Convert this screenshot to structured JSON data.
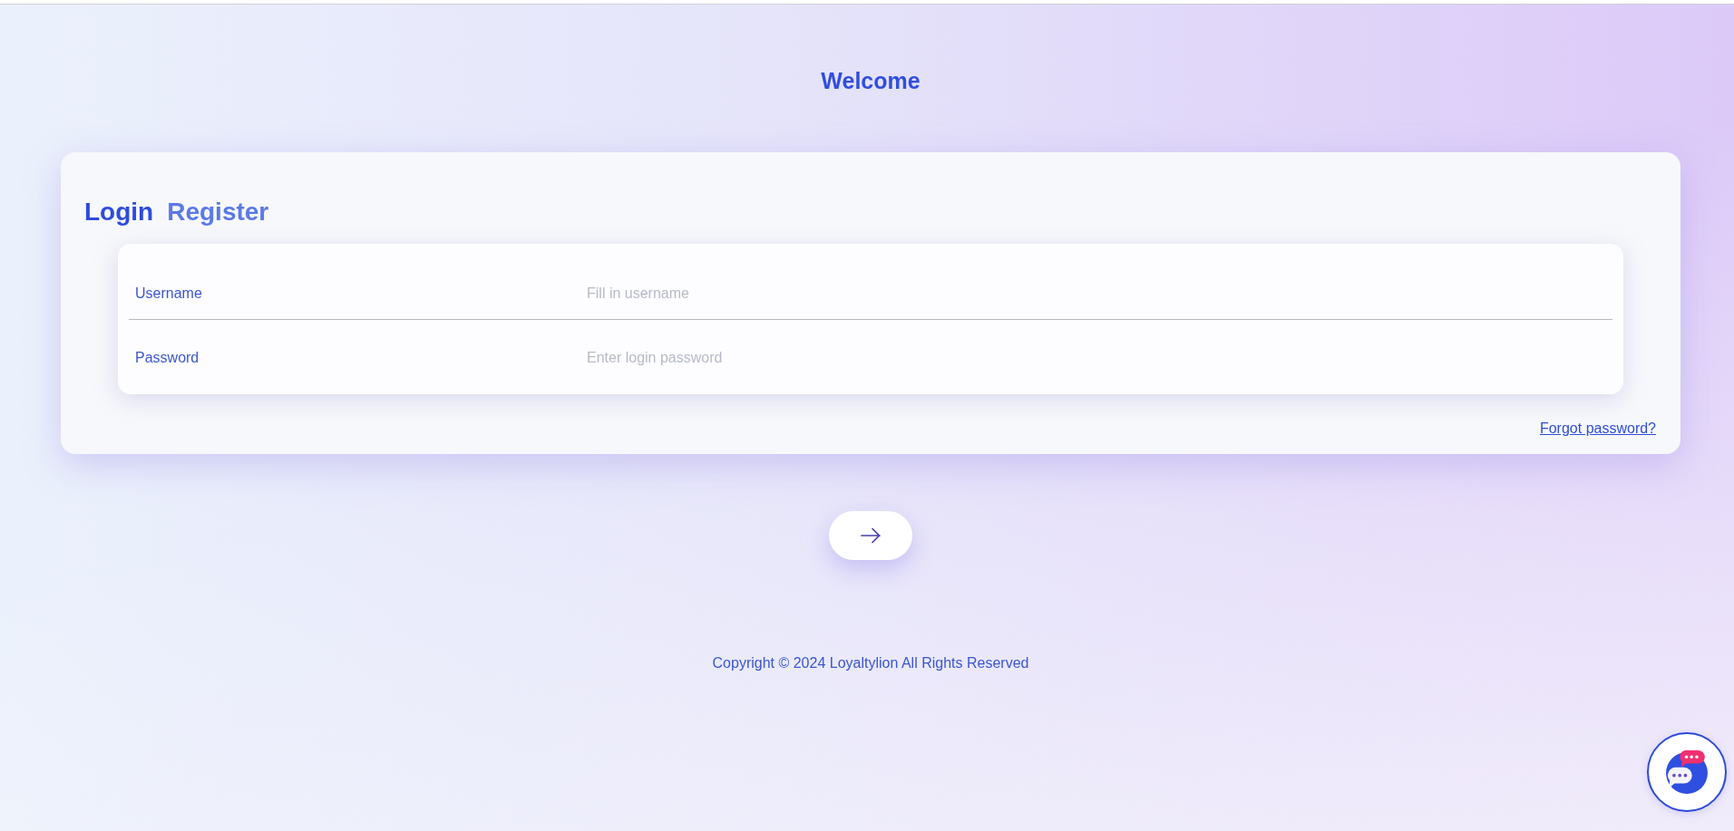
{
  "heading": "Welcome",
  "tabs": [
    {
      "label": "Login",
      "selected": true
    },
    {
      "label": "Register",
      "selected": false
    }
  ],
  "fields": [
    {
      "label": "Username",
      "placeholder": "Fill in username"
    },
    {
      "label": "Password",
      "placeholder": "Enter login password"
    }
  ],
  "forgot_link": "Forgot password?",
  "footer": {
    "copyright": "Copyright © 2024 Loyaltylion All Rights Reserved"
  }
}
